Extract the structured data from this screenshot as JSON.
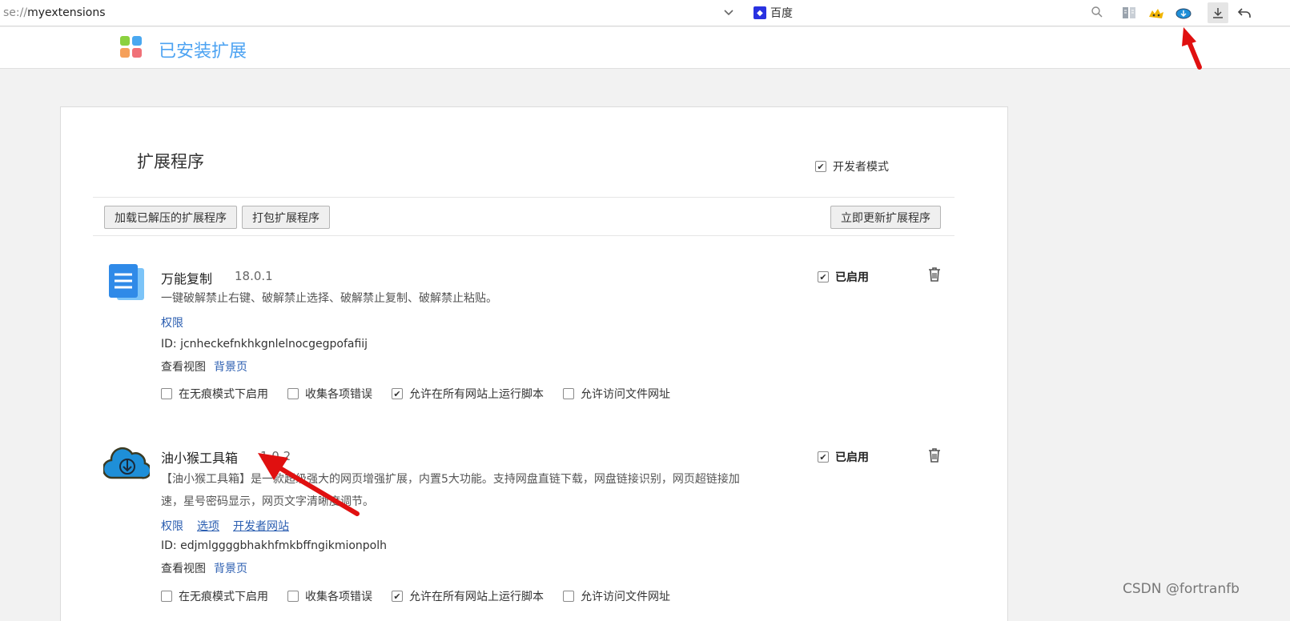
{
  "browser": {
    "url_scheme": "se://",
    "url_path": "myextensions",
    "search_engine": "百度",
    "toolbar_icons": [
      "reader-icon",
      "tampermonkey-icon",
      "cloud-extension-icon",
      "download-icon",
      "undo-icon"
    ]
  },
  "header": {
    "title": "已安装扩展"
  },
  "main": {
    "title": "扩展程序",
    "developer_mode_label": "开发者模式",
    "developer_mode_checked": true,
    "buttons": {
      "load_unpacked": "加载已解压的扩展程序",
      "pack": "打包扩展程序",
      "update_now": "立即更新扩展程序"
    }
  },
  "extensions": [
    {
      "name": "万能复制",
      "version": "18.0.1",
      "description": "一键破解禁止右键、破解禁止选择、破解禁止复制、破解禁止粘贴。",
      "links": [
        "权限"
      ],
      "id_text": "ID: jcnheckefnkhkgnlelnocgegpofafiij",
      "views_label": "查看视图",
      "views_link": "背景页",
      "enabled_label": "已启用",
      "enabled": true,
      "options": [
        {
          "label": "在无痕模式下启用",
          "checked": false
        },
        {
          "label": "收集各项错误",
          "checked": false
        },
        {
          "label": "允许在所有网站上运行脚本",
          "checked": true
        },
        {
          "label": "允许访问文件网址",
          "checked": false
        }
      ]
    },
    {
      "name": "油小猴工具箱",
      "version": "1.0.2",
      "description_line1": "【油小猴工具箱】是一款超级强大的网页增强扩展，内置5大功能。支持网盘直链下载，网盘链接识别，网页超链接加",
      "description_line2": "速，星号密码显示，网页文字清晰度调节。",
      "links": [
        "权限",
        "选项",
        "开发者网站"
      ],
      "id_text": "ID: edjmlggggbhakhfmkbffngikmionpolh",
      "views_label": "查看视图",
      "views_link": "背景页",
      "enabled_label": "已启用",
      "enabled": true,
      "options": [
        {
          "label": "在无痕模式下启用",
          "checked": false
        },
        {
          "label": "收集各项错误",
          "checked": false
        },
        {
          "label": "允许在所有网站上运行脚本",
          "checked": true
        },
        {
          "label": "允许访问文件网址",
          "checked": false
        }
      ]
    }
  ],
  "watermark": "CSDN @fortranfb",
  "colors": {
    "accent": "#4da3f2",
    "link": "#2a5db0",
    "annotation_arrow": "#e01010"
  }
}
